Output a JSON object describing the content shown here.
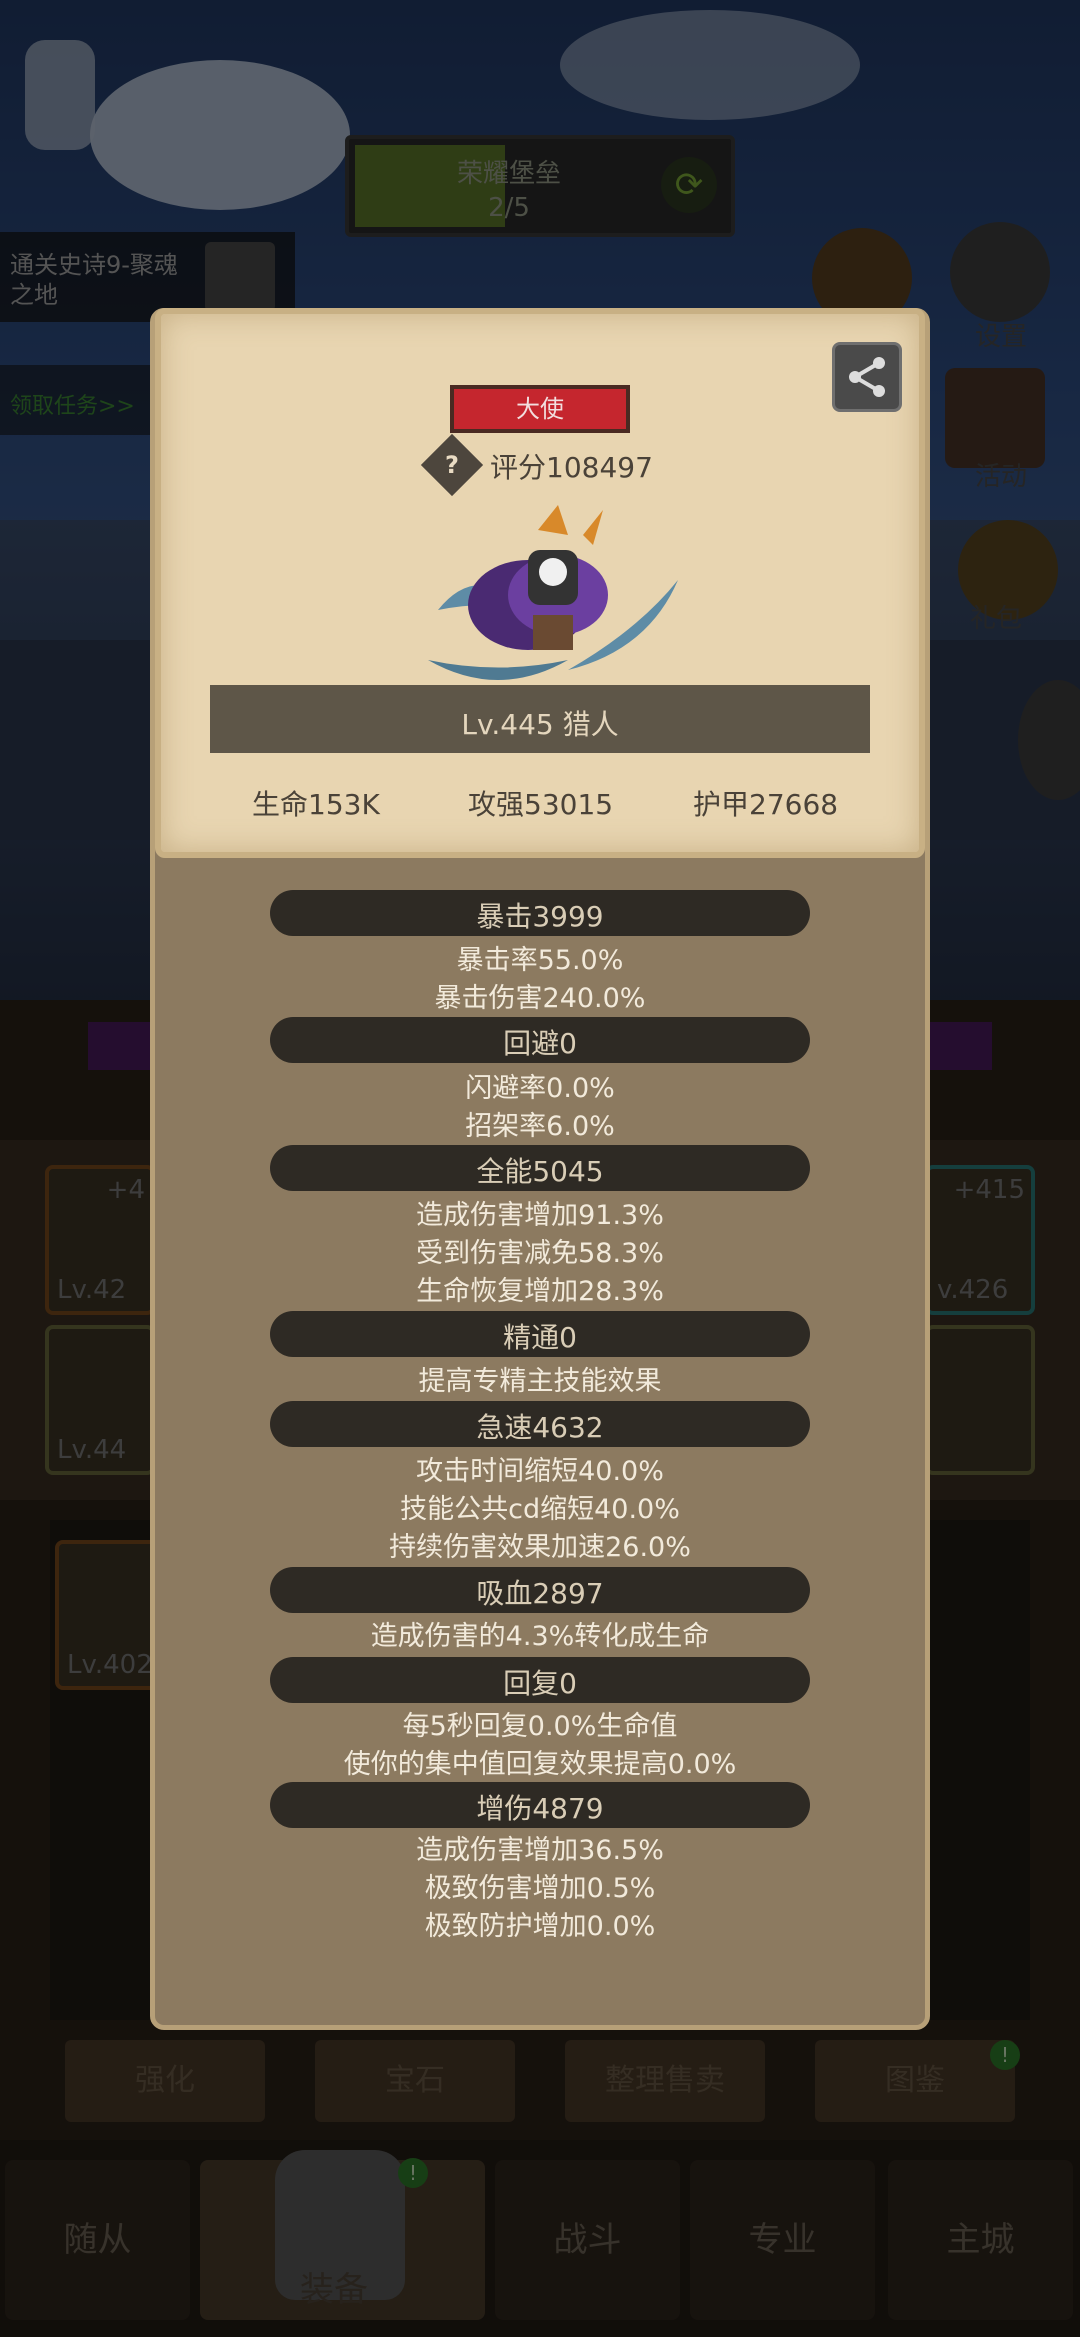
{
  "background": {
    "title": "荣耀堡垒",
    "progress": "2/5",
    "quest": "通关史诗9-聚魂之地",
    "quest_link": "领取任务>>",
    "side_labels": [
      "设置",
      "活动",
      "礼包"
    ],
    "slots": [
      {
        "plus": "+4",
        "lv": "Lv.42"
      },
      {
        "plus": "",
        "lv": "Lv.44"
      },
      {
        "plus": "+415",
        "lv": "v.426"
      },
      {
        "plus": "",
        "lv": "Lv.402"
      }
    ],
    "buttons": [
      "强化",
      "宝石",
      "整理售卖",
      "图鉴"
    ],
    "nav": [
      "随从",
      "装备",
      "战斗",
      "专业",
      "主城"
    ],
    "colors": {
      "accent_green": "#7fae38",
      "badge_red": "#c5262e"
    }
  },
  "popup": {
    "rank": "大使",
    "score": "评分108497",
    "name": "Lv.445 猎人",
    "stats": [
      "生命153K",
      "攻强53015",
      "护甲27668"
    ],
    "sections": [
      {
        "title": "暴击3999",
        "lines": [
          "暴击率55.0%",
          "暴击伤害240.0%"
        ]
      },
      {
        "title": "回避0",
        "lines": [
          "闪避率0.0%",
          "招架率6.0%"
        ]
      },
      {
        "title": "全能5045",
        "lines": [
          "造成伤害增加91.3%",
          "受到伤害减免58.3%",
          "生命恢复增加28.3%"
        ]
      },
      {
        "title": "精通0",
        "lines": [
          "提高专精主技能效果"
        ]
      },
      {
        "title": "急速4632",
        "lines": [
          "攻击时间缩短40.0%",
          "技能公共cd缩短40.0%",
          "持续伤害效果加速26.0%"
        ]
      },
      {
        "title": "吸血2897",
        "lines": [
          "造成伤害的4.3%转化成生命"
        ]
      },
      {
        "title": "回复0",
        "lines": [
          "每5秒回复0.0%生命值",
          "使你的集中值回复效果提高0.0%"
        ]
      },
      {
        "title": "增伤4879",
        "lines": [
          "造成伤害增加36.5%",
          "极致伤害增加0.5%",
          "极致防护增加0.0%"
        ]
      }
    ]
  }
}
